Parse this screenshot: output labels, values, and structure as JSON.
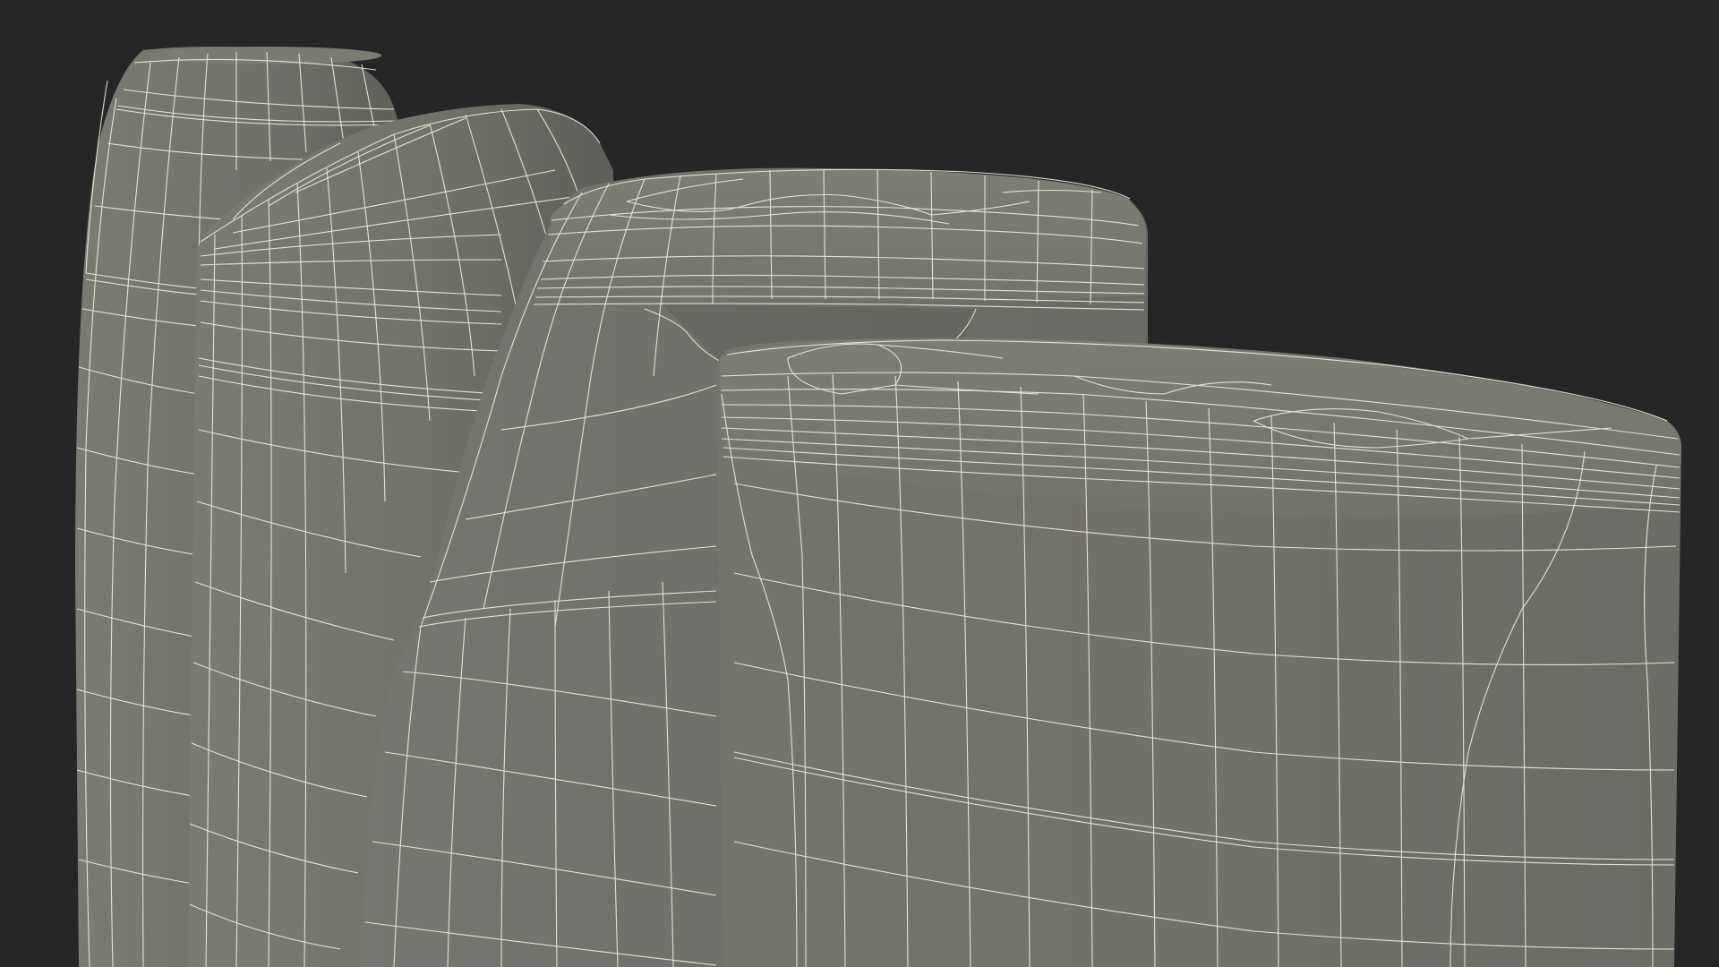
{
  "scene": {
    "subject": "wireframe-render-of-four-bottles",
    "colors": {
      "background": "#262626",
      "surface": "#70716a",
      "surface_light": "#7a7b73",
      "surface_dark": "#5f605a",
      "wire": "#f1eedd"
    },
    "objects": [
      {
        "name": "bottle-back-left"
      },
      {
        "name": "bottle-mid-left"
      },
      {
        "name": "bottle-center"
      },
      {
        "name": "bottle-front-right"
      }
    ]
  }
}
